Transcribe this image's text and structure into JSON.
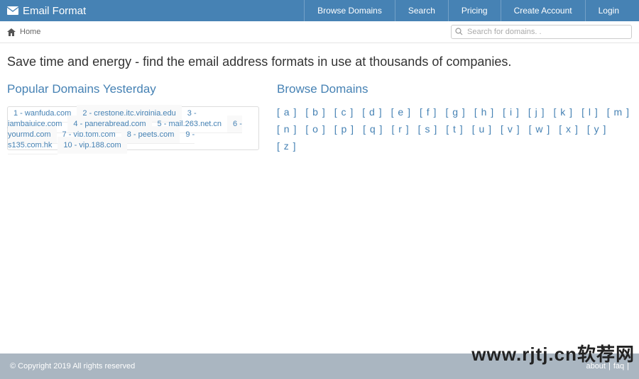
{
  "brand": "Email Format",
  "nav": {
    "browse": "Browse Domains",
    "search": "Search",
    "pricing": "Pricing",
    "create_account": "Create Account",
    "login": "Login"
  },
  "breadcrumb": {
    "home": "Home"
  },
  "search": {
    "placeholder": "Search for domains. ."
  },
  "tagline": "Save time and energy - find the email address formats in use at thousands of companies.",
  "popular": {
    "title": "Popular Domains Yesterday",
    "items": [
      "1 - wanfuda.com",
      "2 - crestone.itc.virginia.edu",
      "3 - jambajuice.com",
      "4 - panerabread.com",
      "5 - mail.263.net.cn",
      "6 - yourmd.com",
      "7 - vip.tom.com",
      "8 - peets.com",
      "9 - s135.com.hk",
      "10 - vip.188.com"
    ]
  },
  "browse": {
    "title": "Browse Domains",
    "letters": [
      "a",
      "b",
      "c",
      "d",
      "e",
      "f",
      "g",
      "h",
      "i",
      "j",
      "k",
      "l",
      "m",
      "n",
      "o",
      "p",
      "q",
      "r",
      "s",
      "t",
      "u",
      "v",
      "w",
      "x",
      "y",
      "z"
    ]
  },
  "footer": {
    "copyright": "© Copyright 2019 All rights reserved",
    "about": "about",
    "faq": "faq",
    "sep": " | "
  },
  "watermark": "www.rjtj.cn软荐网"
}
